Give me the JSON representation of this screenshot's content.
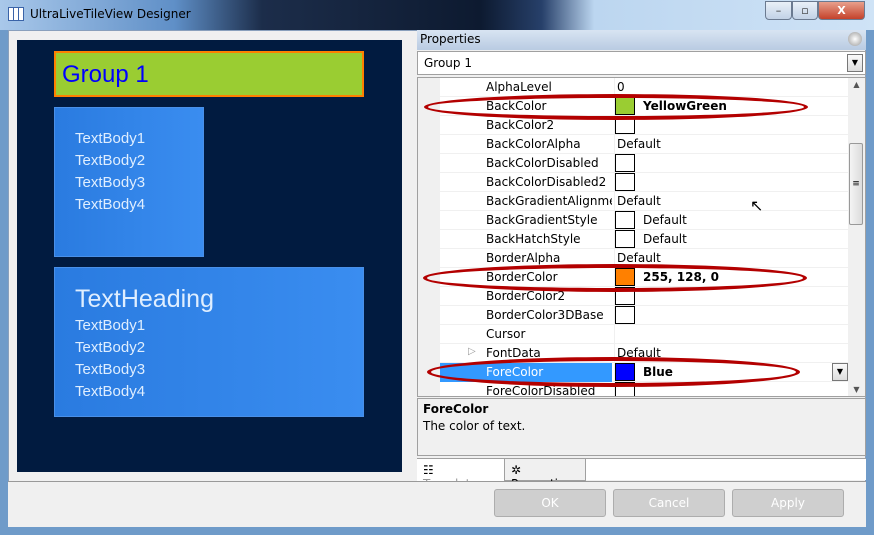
{
  "window": {
    "title": "UltraLiveTileView Designer",
    "minimize": "–",
    "maximize": "▫",
    "close": "X"
  },
  "preview": {
    "group_title": "Group 1",
    "tile1": [
      "TextBody1",
      "TextBody2",
      "TextBody3",
      "TextBody4"
    ],
    "tile2_heading": "TextHeading",
    "tile2": [
      "TextBody1",
      "TextBody2",
      "TextBody3",
      "TextBody4"
    ]
  },
  "properties": {
    "header": "Properties",
    "selected_object": "Group 1",
    "rows": [
      {
        "name": "AlphaLevel",
        "value": "0"
      },
      {
        "name": "BackColor",
        "value": "YellowGreen",
        "swatch": "#9acd32",
        "bold": true
      },
      {
        "name": "BackColor2",
        "value": "",
        "swatch": "#ffffff"
      },
      {
        "name": "BackColorAlpha",
        "value": "Default"
      },
      {
        "name": "BackColorDisabled",
        "value": "",
        "swatch": "#ffffff"
      },
      {
        "name": "BackColorDisabled2",
        "value": "",
        "swatch": "#ffffff"
      },
      {
        "name": "BackGradientAlignment",
        "value": "Default"
      },
      {
        "name": "BackGradientStyle",
        "value": "Default",
        "swatch": "#ffffff"
      },
      {
        "name": "BackHatchStyle",
        "value": "Default",
        "swatch": "#ffffff"
      },
      {
        "name": "BorderAlpha",
        "value": "Default"
      },
      {
        "name": "BorderColor",
        "value": "255, 128, 0",
        "swatch": "#ff8000",
        "bold": true
      },
      {
        "name": "BorderColor2",
        "value": "",
        "swatch": "#ffffff"
      },
      {
        "name": "BorderColor3DBase",
        "value": "",
        "swatch": "#ffffff"
      },
      {
        "name": "Cursor",
        "value": ""
      },
      {
        "name": "FontData",
        "value": "Default",
        "expandable": true
      },
      {
        "name": "ForeColor",
        "value": "Blue",
        "swatch": "#0000ff",
        "bold": true,
        "selected": true
      },
      {
        "name": "ForeColorDisabled",
        "value": "",
        "swatch": "#ffffff"
      }
    ],
    "description_title": "ForeColor",
    "description_text": "The color of text."
  },
  "tabs": [
    {
      "label": "Templates",
      "icon": "grid-icon"
    },
    {
      "label": "Properties",
      "icon": "gear-icon",
      "active": true
    }
  ],
  "buttons": {
    "ok": "OK",
    "cancel": "Cancel",
    "apply": "Apply"
  },
  "colors": {
    "highlight_oval": "#b30000",
    "selection": "#3399ff",
    "canvas": "#011b40"
  }
}
